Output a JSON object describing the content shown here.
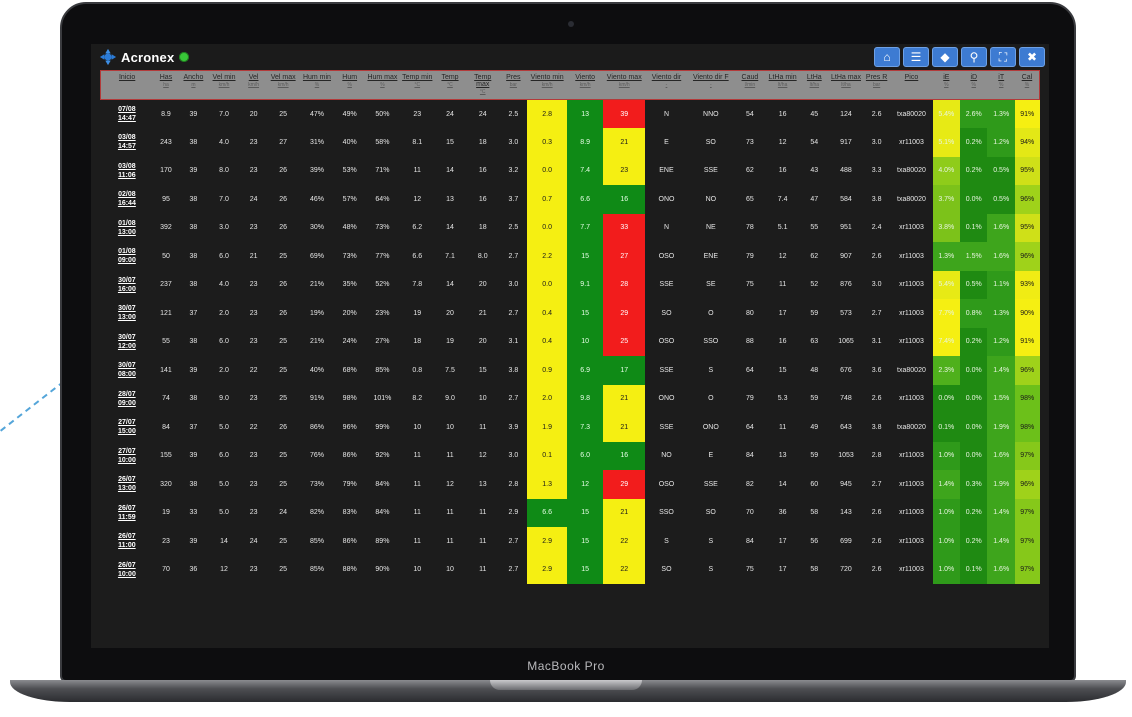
{
  "app": {
    "brand": "Acronex",
    "device_label": "MacBook Pro"
  },
  "icons": {
    "logo": "acronex-logo-icon",
    "status": "online-status-icon"
  },
  "colors": {
    "yellow": "#f5ef12",
    "red": "#f21c1c",
    "green": "#0f8a16",
    "toolbar_button": "#3d7bd2"
  },
  "toolbar": [
    {
      "name": "home-icon",
      "glyph": "⌂"
    },
    {
      "name": "menu-icon",
      "glyph": "☰"
    },
    {
      "name": "tag-icon",
      "glyph": "◆"
    },
    {
      "name": "location-pin-icon",
      "glyph": "⚲"
    },
    {
      "name": "fullscreen-icon",
      "glyph": "⛶"
    },
    {
      "name": "close-icon",
      "glyph": "✖"
    }
  ],
  "columns": [
    {
      "label": "Inicio",
      "unit": ""
    },
    {
      "label": "Has",
      "unit": "ha"
    },
    {
      "label": "Ancho",
      "unit": "m"
    },
    {
      "label": "Vel min",
      "unit": "km/h"
    },
    {
      "label": "Vel",
      "unit": "km/h"
    },
    {
      "label": "Vel max",
      "unit": "km/h"
    },
    {
      "label": "Hum min",
      "unit": "%"
    },
    {
      "label": "Hum",
      "unit": "%"
    },
    {
      "label": "Hum max",
      "unit": "%"
    },
    {
      "label": "Temp min",
      "unit": "°C"
    },
    {
      "label": "Temp",
      "unit": "°C"
    },
    {
      "label": "Temp max",
      "unit": "°C"
    },
    {
      "label": "Pres",
      "unit": "bar"
    },
    {
      "label": "Viento min",
      "unit": "km/h"
    },
    {
      "label": "Viento",
      "unit": "km/h"
    },
    {
      "label": "Viento max",
      "unit": "km/h"
    },
    {
      "label": "Viento dir",
      "unit": "-"
    },
    {
      "label": "Viento dir F",
      "unit": "-"
    },
    {
      "label": "Caud",
      "unit": "l/min"
    },
    {
      "label": "LtHa min",
      "unit": "lt/ha"
    },
    {
      "label": "LtHa",
      "unit": "lt/ha"
    },
    {
      "label": "LtHa max",
      "unit": "lt/ha"
    },
    {
      "label": "Pres R",
      "unit": "bar"
    },
    {
      "label": "Pico",
      "unit": ""
    },
    {
      "label": "iE",
      "unit": "%"
    },
    {
      "label": "iD",
      "unit": "%"
    },
    {
      "label": "iT",
      "unit": "%"
    },
    {
      "label": "Cal",
      "unit": "%"
    }
  ],
  "rows": [
    {
      "inicio": [
        "07/08",
        "14:47"
      ],
      "has": "8.9",
      "ancho": "39",
      "vel_min": "7.0",
      "vel": "20",
      "vel_max": "25",
      "hum_min": "47%",
      "hum": "49%",
      "hum_max": "50%",
      "temp_min": "23",
      "temp": "24",
      "temp_max": "24",
      "pres": "2.5",
      "viento_min": "2.8",
      "viento": "13",
      "viento_max": "39",
      "viento_dir": "N",
      "viento_dir_f": "NNO",
      "caud": "54",
      "ltha_min": "16",
      "ltha": "45",
      "ltha_max": "124",
      "pres_r": "2.6",
      "pico": "txa80020",
      "ie": "5.4%",
      "id": "2.6%",
      "it": "1.3%",
      "cal": "91%",
      "vmin_color": "yellow",
      "v_color": "green",
      "vmax_color": "red",
      "ie_color": "#e7ea15",
      "id_color": "#2f9a1a",
      "it_color": "#2f9a1a",
      "cal_color": "#f5ef12"
    },
    {
      "inicio": [
        "03/08",
        "14:57"
      ],
      "has": "243",
      "ancho": "38",
      "vel_min": "4.0",
      "vel": "23",
      "vel_max": "27",
      "hum_min": "31%",
      "hum": "40%",
      "hum_max": "58%",
      "temp_min": "8.1",
      "temp": "15",
      "temp_max": "18",
      "pres": "3.0",
      "viento_min": "0.3",
      "viento": "8.9",
      "viento_max": "21",
      "viento_dir": "E",
      "viento_dir_f": "SO",
      "caud": "73",
      "ltha_min": "12",
      "ltha": "54",
      "ltha_max": "917",
      "pres_r": "3.0",
      "pico": "xr11003",
      "ie": "5.1%",
      "id": "0.2%",
      "it": "1.2%",
      "cal": "94%",
      "vmin_color": "yellow",
      "v_color": "green",
      "vmax_color": "yellow",
      "ie_color": "#e7ea15",
      "id_color": "#1f8a12",
      "it_color": "#2f9a1a",
      "cal_color": "#e3e816"
    },
    {
      "inicio": [
        "03/08",
        "11:06"
      ],
      "has": "170",
      "ancho": "39",
      "vel_min": "8.0",
      "vel": "23",
      "vel_max": "26",
      "hum_min": "39%",
      "hum": "53%",
      "hum_max": "71%",
      "temp_min": "11",
      "temp": "14",
      "temp_max": "16",
      "pres": "3.2",
      "viento_min": "0.0",
      "viento": "7.4",
      "viento_max": "23",
      "viento_dir": "ENE",
      "viento_dir_f": "SSE",
      "caud": "62",
      "ltha_min": "16",
      "ltha": "43",
      "ltha_max": "488",
      "pres_r": "3.3",
      "pico": "txa80020",
      "ie": "4.0%",
      "id": "0.2%",
      "it": "0.5%",
      "cal": "95%",
      "vmin_color": "yellow",
      "v_color": "green",
      "vmax_color": "yellow",
      "ie_color": "#8fcc1a",
      "id_color": "#1f8a12",
      "it_color": "#1f8a12",
      "cal_color": "#cfe018"
    },
    {
      "inicio": [
        "02/08",
        "16:44"
      ],
      "has": "95",
      "ancho": "38",
      "vel_min": "7.0",
      "vel": "24",
      "vel_max": "26",
      "hum_min": "46%",
      "hum": "57%",
      "hum_max": "64%",
      "temp_min": "12",
      "temp": "13",
      "temp_max": "16",
      "pres": "3.7",
      "viento_min": "0.7",
      "viento": "6.6",
      "viento_max": "16",
      "viento_dir": "ONO",
      "viento_dir_f": "NO",
      "caud": "65",
      "ltha_min": "7.4",
      "ltha": "47",
      "ltha_max": "584",
      "pres_r": "3.8",
      "pico": "txa80020",
      "ie": "3.7%",
      "id": "0.0%",
      "it": "0.5%",
      "cal": "96%",
      "vmin_color": "yellow",
      "v_color": "green",
      "vmax_color": "green",
      "ie_color": "#7cc21a",
      "id_color": "#1f8a12",
      "it_color": "#1f8a12",
      "cal_color": "#9fd21a"
    },
    {
      "inicio": [
        "01/08",
        "13:00"
      ],
      "has": "392",
      "ancho": "38",
      "vel_min": "3.0",
      "vel": "23",
      "vel_max": "26",
      "hum_min": "30%",
      "hum": "48%",
      "hum_max": "73%",
      "temp_min": "6.2",
      "temp": "14",
      "temp_max": "18",
      "pres": "2.5",
      "viento_min": "0.0",
      "viento": "7.7",
      "viento_max": "33",
      "viento_dir": "N",
      "viento_dir_f": "NE",
      "caud": "78",
      "ltha_min": "5.1",
      "ltha": "55",
      "ltha_max": "951",
      "pres_r": "2.4",
      "pico": "xr11003",
      "ie": "3.8%",
      "id": "0.1%",
      "it": "1.6%",
      "cal": "95%",
      "vmin_color": "yellow",
      "v_color": "green",
      "vmax_color": "red",
      "ie_color": "#7cc21a",
      "id_color": "#1f8a12",
      "it_color": "#3ea51c",
      "cal_color": "#cfe018"
    },
    {
      "inicio": [
        "01/08",
        "09:00"
      ],
      "has": "50",
      "ancho": "38",
      "vel_min": "6.0",
      "vel": "21",
      "vel_max": "25",
      "hum_min": "69%",
      "hum": "73%",
      "hum_max": "77%",
      "temp_min": "6.6",
      "temp": "7.1",
      "temp_max": "8.0",
      "pres": "2.7",
      "viento_min": "2.2",
      "viento": "15",
      "viento_max": "27",
      "viento_dir": "OSO",
      "viento_dir_f": "ENE",
      "caud": "79",
      "ltha_min": "12",
      "ltha": "62",
      "ltha_max": "907",
      "pres_r": "2.6",
      "pico": "xr11003",
      "ie": "1.3%",
      "id": "1.5%",
      "it": "1.6%",
      "cal": "96%",
      "vmin_color": "yellow",
      "v_color": "green",
      "vmax_color": "red",
      "ie_color": "#3ea51c",
      "id_color": "#3ea51c",
      "it_color": "#3ea51c",
      "cal_color": "#9fd21a"
    },
    {
      "inicio": [
        "30/07",
        "16:00"
      ],
      "has": "237",
      "ancho": "38",
      "vel_min": "4.0",
      "vel": "23",
      "vel_max": "26",
      "hum_min": "21%",
      "hum": "35%",
      "hum_max": "52%",
      "temp_min": "7.8",
      "temp": "14",
      "temp_max": "20",
      "pres": "3.0",
      "viento_min": "0.0",
      "viento": "9.1",
      "viento_max": "28",
      "viento_dir": "SSE",
      "viento_dir_f": "SE",
      "caud": "75",
      "ltha_min": "11",
      "ltha": "52",
      "ltha_max": "876",
      "pres_r": "3.0",
      "pico": "xr11003",
      "ie": "5.4%",
      "id": "0.5%",
      "it": "1.1%",
      "cal": "93%",
      "vmin_color": "yellow",
      "v_color": "green",
      "vmax_color": "red",
      "ie_color": "#e7ea15",
      "id_color": "#1f8a12",
      "it_color": "#2f9a1a",
      "cal_color": "#f0ec14"
    },
    {
      "inicio": [
        "30/07",
        "13:00"
      ],
      "has": "121",
      "ancho": "37",
      "vel_min": "2.0",
      "vel": "23",
      "vel_max": "26",
      "hum_min": "19%",
      "hum": "20%",
      "hum_max": "23%",
      "temp_min": "19",
      "temp": "20",
      "temp_max": "21",
      "pres": "2.7",
      "viento_min": "0.4",
      "viento": "15",
      "viento_max": "29",
      "viento_dir": "SO",
      "viento_dir_f": "O",
      "caud": "80",
      "ltha_min": "17",
      "ltha": "59",
      "ltha_max": "573",
      "pres_r": "2.7",
      "pico": "xr11003",
      "ie": "7.7%",
      "id": "0.8%",
      "it": "1.3%",
      "cal": "90%",
      "vmin_color": "yellow",
      "v_color": "green",
      "vmax_color": "red",
      "ie_color": "#f5ef12",
      "id_color": "#2f9a1a",
      "it_color": "#2f9a1a",
      "cal_color": "#f5ef12"
    },
    {
      "inicio": [
        "30/07",
        "12:00"
      ],
      "has": "55",
      "ancho": "38",
      "vel_min": "6.0",
      "vel": "23",
      "vel_max": "25",
      "hum_min": "21%",
      "hum": "24%",
      "hum_max": "27%",
      "temp_min": "18",
      "temp": "19",
      "temp_max": "20",
      "pres": "3.1",
      "viento_min": "0.4",
      "viento": "10",
      "viento_max": "25",
      "viento_dir": "OSO",
      "viento_dir_f": "SSO",
      "caud": "88",
      "ltha_min": "16",
      "ltha": "63",
      "ltha_max": "1065",
      "pres_r": "3.1",
      "pico": "xr11003",
      "ie": "7.4%",
      "id": "0.2%",
      "it": "1.2%",
      "cal": "91%",
      "vmin_color": "yellow",
      "v_color": "green",
      "vmax_color": "red",
      "ie_color": "#f5ef12",
      "id_color": "#1f8a12",
      "it_color": "#2f9a1a",
      "cal_color": "#f5ef12"
    },
    {
      "inicio": [
        "30/07",
        "08:00"
      ],
      "has": "141",
      "ancho": "39",
      "vel_min": "2.0",
      "vel": "22",
      "vel_max": "25",
      "hum_min": "40%",
      "hum": "68%",
      "hum_max": "85%",
      "temp_min": "0.8",
      "temp": "7.5",
      "temp_max": "15",
      "pres": "3.8",
      "viento_min": "0.9",
      "viento": "6.9",
      "viento_max": "17",
      "viento_dir": "SSE",
      "viento_dir_f": "S",
      "caud": "64",
      "ltha_min": "15",
      "ltha": "48",
      "ltha_max": "676",
      "pres_r": "3.6",
      "pico": "txa80020",
      "ie": "2.3%",
      "id": "0.0%",
      "it": "1.4%",
      "cal": "96%",
      "vmin_color": "yellow",
      "v_color": "green",
      "vmax_color": "green",
      "ie_color": "#4fb01c",
      "id_color": "#1f8a12",
      "it_color": "#3ea51c",
      "cal_color": "#9fd21a"
    },
    {
      "inicio": [
        "28/07",
        "09:00"
      ],
      "has": "74",
      "ancho": "38",
      "vel_min": "9.0",
      "vel": "23",
      "vel_max": "25",
      "hum_min": "91%",
      "hum": "98%",
      "hum_max": "101%",
      "temp_min": "8.2",
      "temp": "9.0",
      "temp_max": "10",
      "pres": "2.7",
      "viento_min": "2.0",
      "viento": "9.8",
      "viento_max": "21",
      "viento_dir": "ONO",
      "viento_dir_f": "O",
      "caud": "79",
      "ltha_min": "5.3",
      "ltha": "59",
      "ltha_max": "748",
      "pres_r": "2.6",
      "pico": "xr11003",
      "ie": "0.0%",
      "id": "0.0%",
      "it": "1.5%",
      "cal": "98%",
      "vmin_color": "yellow",
      "v_color": "green",
      "vmax_color": "yellow",
      "ie_color": "#1f8a12",
      "id_color": "#1f8a12",
      "it_color": "#3ea51c",
      "cal_color": "#6cc01a"
    },
    {
      "inicio": [
        "27/07",
        "15:00"
      ],
      "has": "84",
      "ancho": "37",
      "vel_min": "5.0",
      "vel": "22",
      "vel_max": "26",
      "hum_min": "86%",
      "hum": "96%",
      "hum_max": "99%",
      "temp_min": "10",
      "temp": "10",
      "temp_max": "11",
      "pres": "3.9",
      "viento_min": "1.9",
      "viento": "7.3",
      "viento_max": "21",
      "viento_dir": "SSE",
      "viento_dir_f": "ONO",
      "caud": "64",
      "ltha_min": "11",
      "ltha": "49",
      "ltha_max": "643",
      "pres_r": "3.8",
      "pico": "txa80020",
      "ie": "0.1%",
      "id": "0.0%",
      "it": "1.9%",
      "cal": "98%",
      "vmin_color": "yellow",
      "v_color": "green",
      "vmax_color": "yellow",
      "ie_color": "#1f8a12",
      "id_color": "#1f8a12",
      "it_color": "#3ea51c",
      "cal_color": "#6cc01a"
    },
    {
      "inicio": [
        "27/07",
        "10:00"
      ],
      "has": "155",
      "ancho": "39",
      "vel_min": "6.0",
      "vel": "23",
      "vel_max": "25",
      "hum_min": "76%",
      "hum": "86%",
      "hum_max": "92%",
      "temp_min": "11",
      "temp": "11",
      "temp_max": "12",
      "pres": "3.0",
      "viento_min": "0.1",
      "viento": "6.0",
      "viento_max": "16",
      "viento_dir": "NO",
      "viento_dir_f": "E",
      "caud": "84",
      "ltha_min": "13",
      "ltha": "59",
      "ltha_max": "1053",
      "pres_r": "2.8",
      "pico": "xr11003",
      "ie": "1.0%",
      "id": "0.0%",
      "it": "1.6%",
      "cal": "97%",
      "vmin_color": "yellow",
      "v_color": "green",
      "vmax_color": "green",
      "ie_color": "#2f9a1a",
      "id_color": "#1f8a12",
      "it_color": "#3ea51c",
      "cal_color": "#86c81a"
    },
    {
      "inicio": [
        "26/07",
        "13:00"
      ],
      "has": "320",
      "ancho": "38",
      "vel_min": "5.0",
      "vel": "23",
      "vel_max": "25",
      "hum_min": "73%",
      "hum": "79%",
      "hum_max": "84%",
      "temp_min": "11",
      "temp": "12",
      "temp_max": "13",
      "pres": "2.8",
      "viento_min": "1.3",
      "viento": "12",
      "viento_max": "29",
      "viento_dir": "OSO",
      "viento_dir_f": "SSE",
      "caud": "82",
      "ltha_min": "14",
      "ltha": "60",
      "ltha_max": "945",
      "pres_r": "2.7",
      "pico": "xr11003",
      "ie": "1.4%",
      "id": "0.3%",
      "it": "1.9%",
      "cal": "96%",
      "vmin_color": "yellow",
      "v_color": "green",
      "vmax_color": "red",
      "ie_color": "#3ea51c",
      "id_color": "#1f8a12",
      "it_color": "#3ea51c",
      "cal_color": "#9fd21a"
    },
    {
      "inicio": [
        "26/07",
        "11:59"
      ],
      "has": "19",
      "ancho": "33",
      "vel_min": "5.0",
      "vel": "23",
      "vel_max": "24",
      "hum_min": "82%",
      "hum": "83%",
      "hum_max": "84%",
      "temp_min": "11",
      "temp": "11",
      "temp_max": "11",
      "pres": "2.9",
      "viento_min": "6.6",
      "viento": "15",
      "viento_max": "21",
      "viento_dir": "SSO",
      "viento_dir_f": "SO",
      "caud": "70",
      "ltha_min": "36",
      "ltha": "58",
      "ltha_max": "143",
      "pres_r": "2.6",
      "pico": "xr11003",
      "ie": "1.0%",
      "id": "0.2%",
      "it": "1.4%",
      "cal": "97%",
      "vmin_color": "green",
      "v_color": "green",
      "vmax_color": "yellow",
      "ie_color": "#2f9a1a",
      "id_color": "#1f8a12",
      "it_color": "#3ea51c",
      "cal_color": "#86c81a"
    },
    {
      "inicio": [
        "26/07",
        "11:00"
      ],
      "has": "23",
      "ancho": "39",
      "vel_min": "14",
      "vel": "24",
      "vel_max": "25",
      "hum_min": "85%",
      "hum": "86%",
      "hum_max": "89%",
      "temp_min": "11",
      "temp": "11",
      "temp_max": "11",
      "pres": "2.7",
      "viento_min": "2.9",
      "viento": "15",
      "viento_max": "22",
      "viento_dir": "S",
      "viento_dir_f": "S",
      "caud": "84",
      "ltha_min": "17",
      "ltha": "56",
      "ltha_max": "699",
      "pres_r": "2.6",
      "pico": "xr11003",
      "ie": "1.0%",
      "id": "0.2%",
      "it": "1.4%",
      "cal": "97%",
      "vmin_color": "yellow",
      "v_color": "green",
      "vmax_color": "yellow",
      "ie_color": "#2f9a1a",
      "id_color": "#1f8a12",
      "it_color": "#3ea51c",
      "cal_color": "#86c81a"
    },
    {
      "inicio": [
        "26/07",
        "10:00"
      ],
      "has": "70",
      "ancho": "36",
      "vel_min": "12",
      "vel": "23",
      "vel_max": "25",
      "hum_min": "85%",
      "hum": "88%",
      "hum_max": "90%",
      "temp_min": "10",
      "temp": "10",
      "temp_max": "11",
      "pres": "2.7",
      "viento_min": "2.9",
      "viento": "15",
      "viento_max": "22",
      "viento_dir": "SO",
      "viento_dir_f": "S",
      "caud": "75",
      "ltha_min": "17",
      "ltha": "58",
      "ltha_max": "720",
      "pres_r": "2.6",
      "pico": "xr11003",
      "ie": "1.0%",
      "id": "0.1%",
      "it": "1.6%",
      "cal": "97%",
      "vmin_color": "yellow",
      "v_color": "green",
      "vmax_color": "yellow",
      "ie_color": "#2f9a1a",
      "id_color": "#1f8a12",
      "it_color": "#3ea51c",
      "cal_color": "#86c81a"
    }
  ]
}
